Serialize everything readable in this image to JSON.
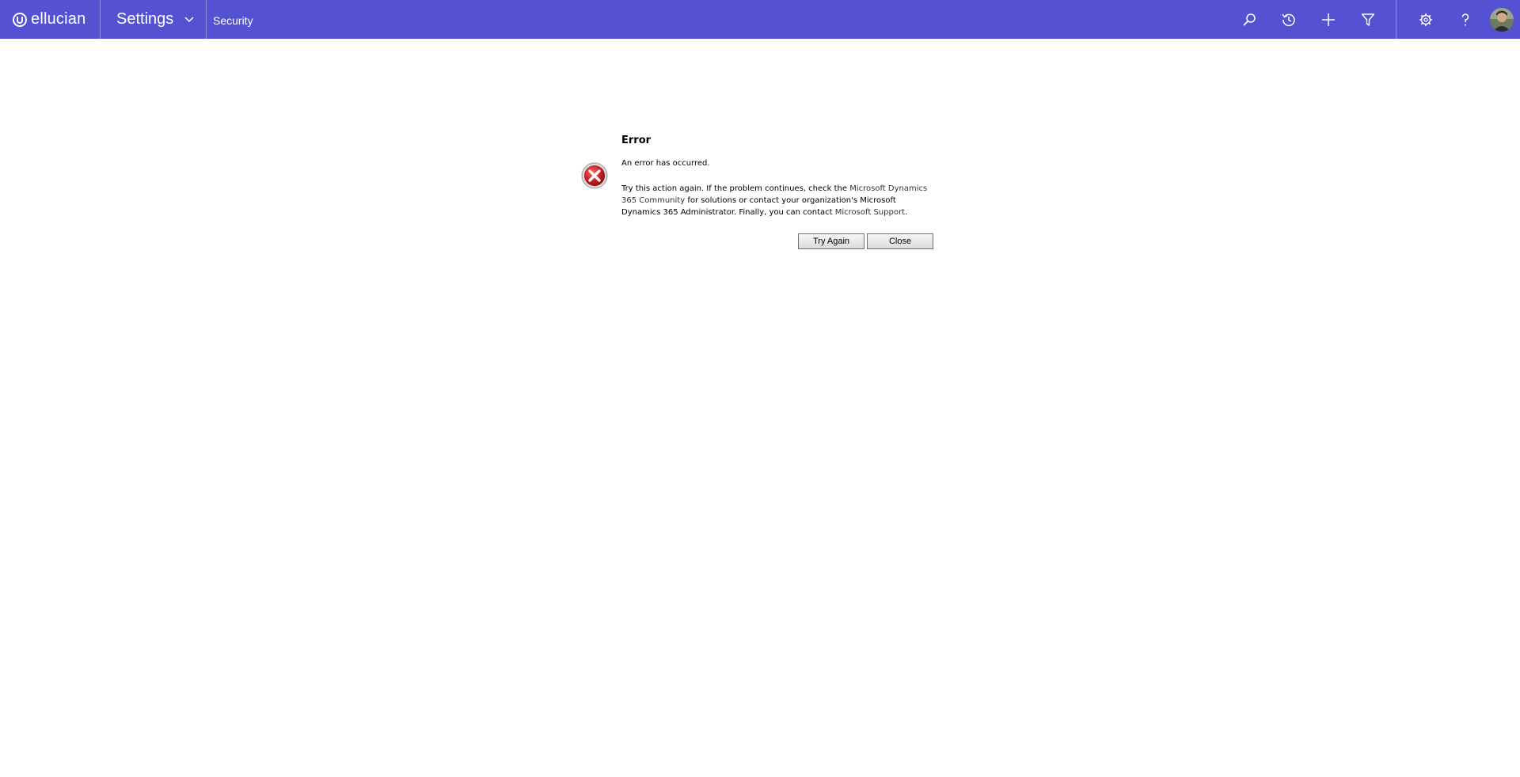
{
  "colors": {
    "nav_background": "#5452d3",
    "nav_foreground": "#ffffff",
    "error_red": "#cc1f24"
  },
  "navbar": {
    "brand": "ellucian",
    "area": "Settings",
    "breadcrumb": "Security",
    "icons": [
      "search-icon",
      "history-icon",
      "add-icon",
      "filter-icon",
      "settings-icon",
      "help-icon",
      "avatar"
    ]
  },
  "dialog": {
    "title": "Error",
    "message": "An error has occurred.",
    "detail": {
      "part1": "Try this action again. If the problem continues, check the ",
      "link1": "Microsoft Dynamics 365 Community",
      "part2": " for solutions or contact your organization's Microsoft Dynamics 365 Administrator. Finally, you can contact ",
      "link2": "Microsoft Support",
      "part3": "."
    },
    "buttons": {
      "try_again": "Try Again",
      "close": "Close"
    }
  }
}
